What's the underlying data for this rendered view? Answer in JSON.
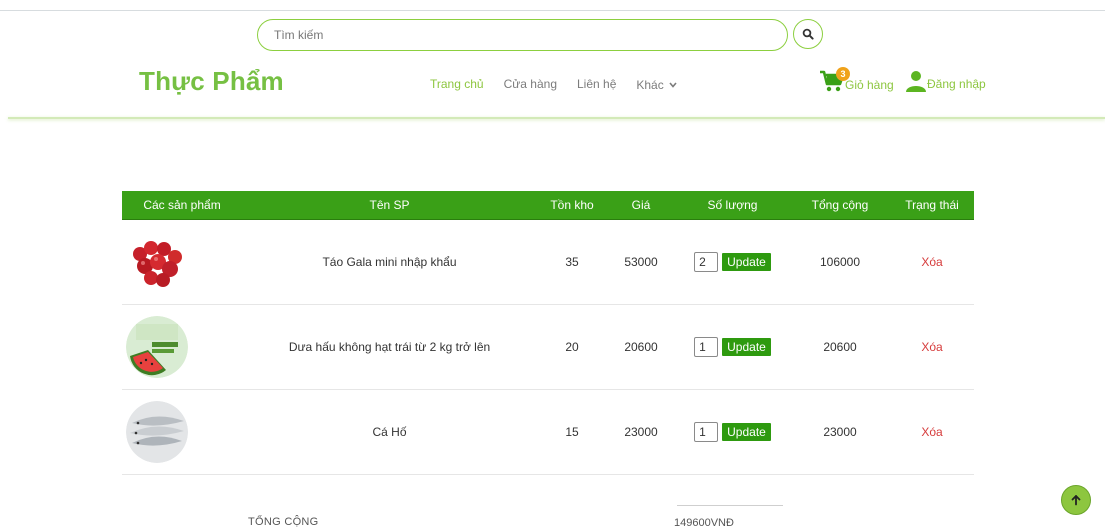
{
  "header": {
    "search_placeholder": "Tìm kiếm",
    "search_icon": "search-icon",
    "brand": "Thực Phẩm",
    "nav": [
      {
        "label": "Trang chủ",
        "active": true
      },
      {
        "label": "Cửa hàng",
        "active": false
      },
      {
        "label": "Liên hệ",
        "active": false
      },
      {
        "label": "Khác",
        "active": false,
        "dropdown": true
      }
    ],
    "cart": {
      "label": "Giỏ hàng",
      "count": "3",
      "icon": "cart-icon"
    },
    "login": {
      "label": "Đăng nhập",
      "icon": "user-icon"
    }
  },
  "table": {
    "headers": [
      "Các sản phẩm",
      "Tên SP",
      "Tồn kho",
      "Giá",
      "Số lượng",
      "Tổng cộng",
      "Trạng thái"
    ],
    "rows": [
      {
        "name": "Táo Gala mini nhập khẩu",
        "stock": "35",
        "price": "53000",
        "qty": "2",
        "update": "Update",
        "total": "106000",
        "action": "Xóa"
      },
      {
        "name": "Dưa hấu không hạt trái từ 2 kg trở lên",
        "stock": "20",
        "price": "20600",
        "qty": "1",
        "update": "Update",
        "total": "20600",
        "action": "Xóa"
      },
      {
        "name": "Cá Hố",
        "stock": "15",
        "price": "23000",
        "qty": "1",
        "update": "Update",
        "total": "23000",
        "action": "Xóa"
      }
    ]
  },
  "summary": {
    "label": "TỔNG CỘNG",
    "value": "149600VNĐ"
  },
  "colors": {
    "brand": "#76c043",
    "accent": "#8dc63f",
    "table_header": "#3aa017",
    "delete": "#d63b3b",
    "badge": "#f0a21a"
  }
}
